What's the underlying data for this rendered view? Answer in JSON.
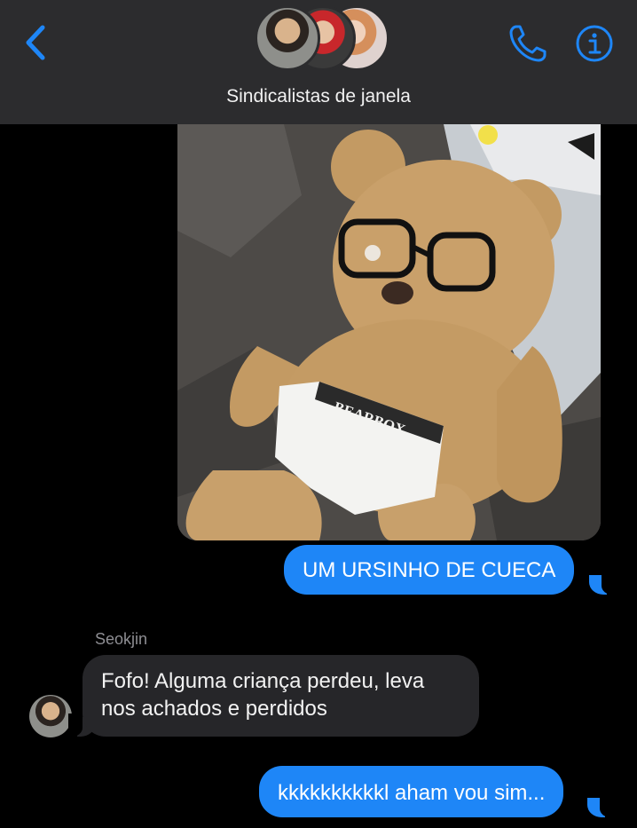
{
  "header": {
    "title": "Sindicalistas de janela",
    "back_icon": "chevron-left-icon",
    "call_icon": "phone-icon",
    "info_icon": "info-icon",
    "accent_color": "#1e86f7"
  },
  "messages": [
    {
      "type": "image",
      "direction": "outgoing",
      "content": "teddy bear wearing glasses and underwear",
      "printed_text": "BEARBOX"
    },
    {
      "type": "text",
      "direction": "outgoing",
      "text": "UM URSINHO DE CUECA"
    },
    {
      "type": "text",
      "direction": "incoming",
      "sender": "Seokjin",
      "lines": [
        "Fofo! Alguma criança perdeu, leva",
        "nos achados e perdidos"
      ]
    },
    {
      "type": "text",
      "direction": "outgoing",
      "text": "kkkkkkkkkkl aham vou sim..."
    }
  ]
}
